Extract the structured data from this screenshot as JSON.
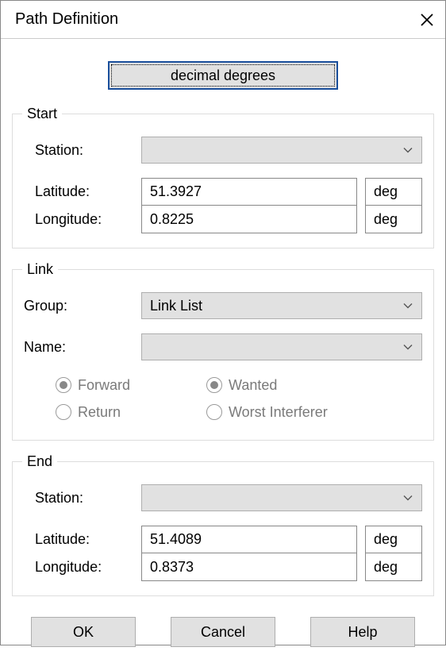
{
  "window": {
    "title": "Path Definition"
  },
  "format_button": "decimal degrees",
  "start": {
    "legend": "Start",
    "station_label": "Station:",
    "station_value": "",
    "lat_label": "Latitude:",
    "lat_value": "51.3927",
    "lat_unit": "deg",
    "lon_label": "Longitude:",
    "lon_value": "0.8225",
    "lon_unit": "deg"
  },
  "link": {
    "legend": "Link",
    "group_label": "Group:",
    "group_value": "Link List",
    "name_label": "Name:",
    "name_value": "",
    "radios": {
      "forward": "Forward",
      "return": "Return",
      "wanted": "Wanted",
      "worst": "Worst Interferer"
    }
  },
  "end": {
    "legend": "End",
    "station_label": "Station:",
    "station_value": "",
    "lat_label": "Latitude:",
    "lat_value": "51.4089",
    "lat_unit": "deg",
    "lon_label": "Longitude:",
    "lon_value": "0.8373",
    "lon_unit": "deg"
  },
  "buttons": {
    "ok": "OK",
    "cancel": "Cancel",
    "help": "Help"
  }
}
